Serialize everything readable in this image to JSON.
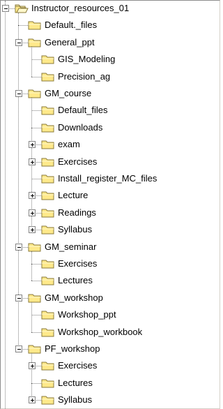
{
  "tree": [
    {
      "label": "Instructor_resources_01",
      "depth": 0,
      "state": "open",
      "open_icon": true
    },
    {
      "label": "Default._files",
      "depth": 1,
      "state": "leaf"
    },
    {
      "label": "General_ppt",
      "depth": 1,
      "state": "open"
    },
    {
      "label": "GIS_Modeling",
      "depth": 2,
      "state": "leaf"
    },
    {
      "label": "Precision_ag",
      "depth": 2,
      "state": "leaf"
    },
    {
      "label": "GM_course",
      "depth": 1,
      "state": "open"
    },
    {
      "label": "Default_files",
      "depth": 2,
      "state": "leaf"
    },
    {
      "label": "Downloads",
      "depth": 2,
      "state": "leaf"
    },
    {
      "label": "exam",
      "depth": 2,
      "state": "closed"
    },
    {
      "label": "Exercises",
      "depth": 2,
      "state": "closed"
    },
    {
      "label": "Install_register_MC_files",
      "depth": 2,
      "state": "leaf"
    },
    {
      "label": "Lecture",
      "depth": 2,
      "state": "closed"
    },
    {
      "label": "Readings",
      "depth": 2,
      "state": "closed"
    },
    {
      "label": "Syllabus",
      "depth": 2,
      "state": "closed"
    },
    {
      "label": "GM_seminar",
      "depth": 1,
      "state": "open"
    },
    {
      "label": "Exercises",
      "depth": 2,
      "state": "leaf"
    },
    {
      "label": "Lectures",
      "depth": 2,
      "state": "leaf"
    },
    {
      "label": "GM_workshop",
      "depth": 1,
      "state": "open"
    },
    {
      "label": "Workshop_ppt",
      "depth": 2,
      "state": "leaf"
    },
    {
      "label": "Workshop_workbook",
      "depth": 2,
      "state": "leaf"
    },
    {
      "label": "PF_workshop",
      "depth": 1,
      "state": "open"
    },
    {
      "label": "Exercises",
      "depth": 2,
      "state": "closed"
    },
    {
      "label": "Lectures",
      "depth": 2,
      "state": "leaf"
    },
    {
      "label": "Syllabus",
      "depth": 2,
      "state": "closed"
    }
  ],
  "icons": {
    "folder": "folder-icon",
    "folder_open": "folder-open-icon",
    "expand": "plus-icon",
    "collapse": "minus-icon"
  },
  "colors": {
    "folder_fill": "#ffe98a",
    "folder_stroke": "#8a7a3a",
    "line": "#808080"
  }
}
